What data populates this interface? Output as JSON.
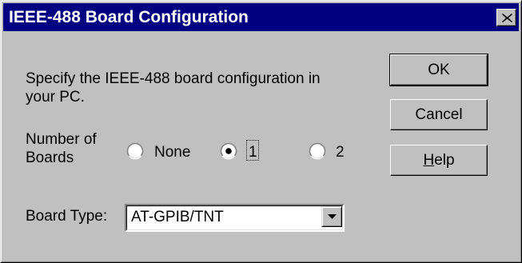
{
  "window": {
    "title": "IEEE-488 Board Configuration",
    "close_label": "×"
  },
  "description": {
    "line1": "Specify the IEEE-488 board configuration in",
    "line2": "your PC."
  },
  "boards": {
    "label_line1": "Number of",
    "label_line2": "Boards",
    "options": [
      {
        "label": "None",
        "selected": false
      },
      {
        "label": "1",
        "selected": true
      },
      {
        "label": "2",
        "selected": false
      }
    ]
  },
  "board_type": {
    "label": "Board Type:",
    "value": "AT-GPIB/TNT"
  },
  "buttons": {
    "ok": "OK",
    "cancel": "Cancel",
    "help_mnemonic": "H",
    "help_rest": "elp"
  },
  "colors": {
    "titlebar": "#000080",
    "face": "#c0c0c0"
  }
}
